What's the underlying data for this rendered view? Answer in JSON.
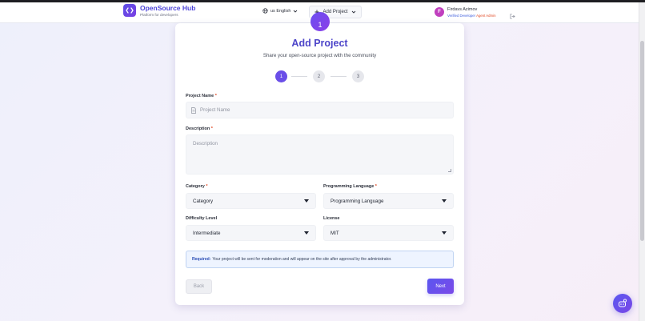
{
  "app": {
    "brand_title": "OpenSource Hub",
    "brand_sub": "Platform for developers"
  },
  "nav": {
    "language_label": "us English",
    "add_project_label": "Add Project"
  },
  "user": {
    "initial": "F",
    "name": "Firdavs Azimov",
    "role_verified": "Verified Developer",
    "role_admin": "Agent Admin"
  },
  "form": {
    "step_icon": "1",
    "title": "Add Project",
    "subtitle": "Share your open-source project with the community",
    "steps": [
      "1",
      "2",
      "3"
    ],
    "project_name_label": "Project Name",
    "project_name_placeholder": "Project Name",
    "description_label": "Description",
    "description_placeholder": "Description",
    "category_label": "Category",
    "category_value": "Category",
    "language_label": "Programming Language",
    "language_value": "Programming Language",
    "difficulty_label": "Difficulty Level",
    "difficulty_value": "Intermediate",
    "license_label": "License",
    "license_value": "MIT",
    "required_mark": "*",
    "notice_strong": "Required:",
    "notice_text": "Your project will be sent for moderation and will appear on the site after approval by the administrator.",
    "back_label": "Back",
    "next_label": "Next"
  },
  "colors": {
    "accent": "#4f46d8",
    "admin_role": "#e0451f",
    "verified_role": "#3b5bdb"
  },
  "icons": {
    "logo": "code-brackets-icon",
    "globe": "globe-icon",
    "plus": "plus-icon",
    "chevron": "chevron-down-icon",
    "logout": "logout-icon",
    "file": "file-icon",
    "fab": "chat-bot-icon"
  }
}
